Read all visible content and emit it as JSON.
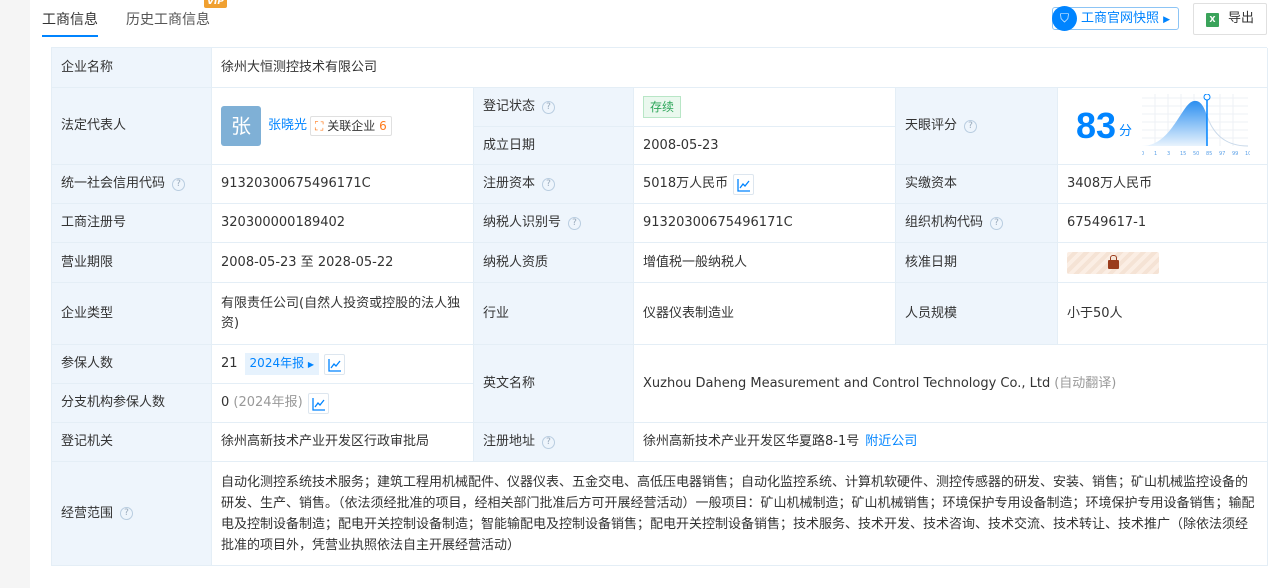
{
  "tabs": {
    "business": "工商信息",
    "history": "历史工商信息",
    "vip": "VIP"
  },
  "actions": {
    "snapshot": "工商官网快照",
    "export": "导出"
  },
  "labels": {
    "company_name": "企业名称",
    "legal_rep": "法定代表人",
    "reg_status": "登记状态",
    "founded": "成立日期",
    "score": "天眼评分",
    "credit_code": "统一社会信用代码",
    "reg_capital": "注册资本",
    "paid_capital": "实缴资本",
    "reg_no": "工商注册号",
    "taxpayer_id": "纳税人识别号",
    "org_code": "组织机构代码",
    "term": "营业期限",
    "taxpayer_type": "纳税人资质",
    "approval_date": "核准日期",
    "company_type": "企业类型",
    "industry": "行业",
    "staff_size": "人员规模",
    "insured": "参保人数",
    "english_name": "英文名称",
    "branch_insured": "分支机构参保人数",
    "reg_authority": "登记机关",
    "reg_address": "注册地址",
    "scope": "经营范围"
  },
  "values": {
    "company_name": "徐州大恒测控技术有限公司",
    "legal_rep_avatar": "张",
    "legal_rep": "张晓光",
    "related_label": "关联企业",
    "related_count": "6",
    "reg_status": "存续",
    "founded": "2008-05-23",
    "score": "83",
    "score_unit": "分",
    "score_ticks": [
      "0",
      "1",
      "3",
      "15",
      "50",
      "85",
      "97",
      "99",
      "100"
    ],
    "credit_code": "91320300675496171C",
    "reg_capital": "5018万人民币",
    "paid_capital": "3408万人民币",
    "reg_no": "320300000189402",
    "taxpayer_id": "91320300675496171C",
    "org_code": "67549617-1",
    "term": "2008-05-23 至 2028-05-22",
    "taxpayer_type": "增值税一般纳税人",
    "company_type": "有限责任公司(自然人投资或控股的法人独资)",
    "industry": "仪器仪表制造业",
    "staff_size": "小于50人",
    "insured": "21",
    "insured_report": "2024年报",
    "english_name": "Xuzhou Daheng Measurement and Control Technology Co., Ltd",
    "english_note": "(自动翻译)",
    "branch_insured": "0",
    "branch_report": "(2024年报)",
    "reg_authority": "徐州高新技术产业开发区行政审批局",
    "reg_address": "徐州高新技术产业开发区华夏路8-1号",
    "nearby": "附近公司",
    "scope": "自动化测控系统技术服务；建筑工程用机械配件、仪器仪表、五金交电、高低压电器销售；自动化监控系统、计算机软硬件、测控传感器的研发、安装、销售；矿山机械监控设备的研发、生产、销售。（依法须经批准的项目，经相关部门批准后方可开展经营活动）一般项目：矿山机械制造；矿山机械销售；环境保护专用设备制造；环境保护专用设备销售；输配电及控制设备制造；配电开关控制设备制造；智能输配电及控制设备销售；配电开关控制设备销售；技术服务、技术开发、技术咨询、技术交流、技术转让、技术推广（除依法须经批准的项目外，凭营业执照依法自主开展经营活动）"
  }
}
